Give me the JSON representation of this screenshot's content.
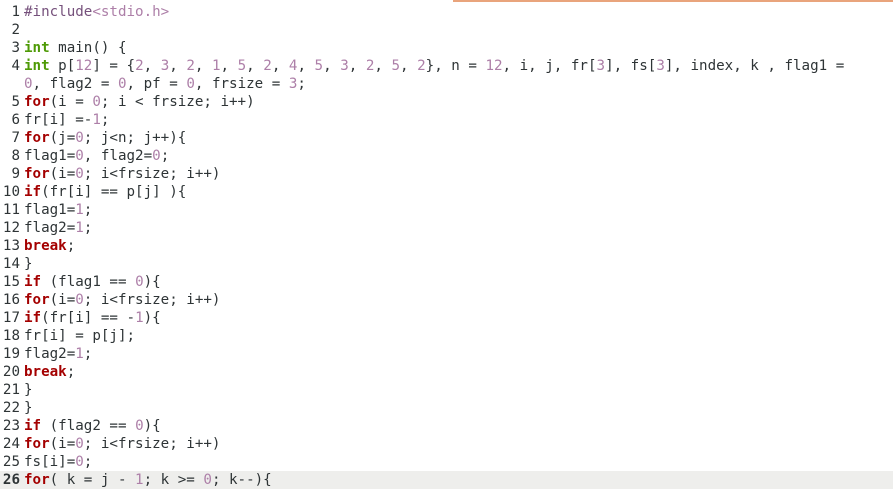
{
  "colors": {
    "keyword": "#a40000",
    "type": "#4e9a06",
    "preprocessor": "#75507b",
    "number": "#ad7fa8",
    "default": "#2e3436",
    "current_line_bg": "#eeeeec",
    "accent": "#e9a47c"
  },
  "editor": {
    "current_line": 26,
    "lines": [
      {
        "n": "1",
        "tokens": [
          {
            "t": "pp",
            "v": "#include"
          },
          {
            "t": "str",
            "v": "<stdio.h>"
          }
        ]
      },
      {
        "n": "2",
        "tokens": []
      },
      {
        "n": "3",
        "tokens": [
          {
            "t": "ty",
            "v": "int"
          },
          {
            "t": "",
            "v": " main() {"
          }
        ]
      },
      {
        "n": "4",
        "tokens": [
          {
            "t": "ty",
            "v": "int"
          },
          {
            "t": "",
            "v": " p["
          },
          {
            "t": "num",
            "v": "12"
          },
          {
            "t": "",
            "v": "] = {"
          },
          {
            "t": "num",
            "v": "2"
          },
          {
            "t": "",
            "v": ", "
          },
          {
            "t": "num",
            "v": "3"
          },
          {
            "t": "",
            "v": ", "
          },
          {
            "t": "num",
            "v": "2"
          },
          {
            "t": "",
            "v": ", "
          },
          {
            "t": "num",
            "v": "1"
          },
          {
            "t": "",
            "v": ", "
          },
          {
            "t": "num",
            "v": "5"
          },
          {
            "t": "",
            "v": ", "
          },
          {
            "t": "num",
            "v": "2"
          },
          {
            "t": "",
            "v": ", "
          },
          {
            "t": "num",
            "v": "4"
          },
          {
            "t": "",
            "v": ", "
          },
          {
            "t": "num",
            "v": "5"
          },
          {
            "t": "",
            "v": ", "
          },
          {
            "t": "num",
            "v": "3"
          },
          {
            "t": "",
            "v": ", "
          },
          {
            "t": "num",
            "v": "2"
          },
          {
            "t": "",
            "v": ", "
          },
          {
            "t": "num",
            "v": "5"
          },
          {
            "t": "",
            "v": ", "
          },
          {
            "t": "num",
            "v": "2"
          },
          {
            "t": "",
            "v": "}, n = "
          },
          {
            "t": "num",
            "v": "12"
          },
          {
            "t": "",
            "v": ", i, j, fr["
          },
          {
            "t": "num",
            "v": "3"
          },
          {
            "t": "",
            "v": "], fs["
          },
          {
            "t": "num",
            "v": "3"
          },
          {
            "t": "",
            "v": "], index, k , flag1 ="
          }
        ]
      },
      {
        "n": "",
        "tokens": [
          {
            "t": "num",
            "v": "0"
          },
          {
            "t": "",
            "v": ", flag2 = "
          },
          {
            "t": "num",
            "v": "0"
          },
          {
            "t": "",
            "v": ", pf = "
          },
          {
            "t": "num",
            "v": "0"
          },
          {
            "t": "",
            "v": ", frsize = "
          },
          {
            "t": "num",
            "v": "3"
          },
          {
            "t": "",
            "v": ";"
          }
        ]
      },
      {
        "n": "5",
        "tokens": [
          {
            "t": "kw",
            "v": "for"
          },
          {
            "t": "",
            "v": "(i = "
          },
          {
            "t": "num",
            "v": "0"
          },
          {
            "t": "",
            "v": "; i < frsize; i++)"
          }
        ]
      },
      {
        "n": "6",
        "tokens": [
          {
            "t": "",
            "v": "fr[i] =-"
          },
          {
            "t": "num",
            "v": "1"
          },
          {
            "t": "",
            "v": ";"
          }
        ]
      },
      {
        "n": "7",
        "tokens": [
          {
            "t": "kw",
            "v": "for"
          },
          {
            "t": "",
            "v": "(j="
          },
          {
            "t": "num",
            "v": "0"
          },
          {
            "t": "",
            "v": "; j<n; j++){"
          }
        ]
      },
      {
        "n": "8",
        "tokens": [
          {
            "t": "",
            "v": "flag1="
          },
          {
            "t": "num",
            "v": "0"
          },
          {
            "t": "",
            "v": ", flag2="
          },
          {
            "t": "num",
            "v": "0"
          },
          {
            "t": "",
            "v": ";"
          }
        ]
      },
      {
        "n": "9",
        "tokens": [
          {
            "t": "kw",
            "v": "for"
          },
          {
            "t": "",
            "v": "(i="
          },
          {
            "t": "num",
            "v": "0"
          },
          {
            "t": "",
            "v": "; i<frsize; i++)"
          }
        ]
      },
      {
        "n": "10",
        "tokens": [
          {
            "t": "kw",
            "v": "if"
          },
          {
            "t": "",
            "v": "(fr[i] == p[j] ){"
          }
        ]
      },
      {
        "n": "11",
        "tokens": [
          {
            "t": "",
            "v": "flag1="
          },
          {
            "t": "num",
            "v": "1"
          },
          {
            "t": "",
            "v": ";"
          }
        ]
      },
      {
        "n": "12",
        "tokens": [
          {
            "t": "",
            "v": "flag2="
          },
          {
            "t": "num",
            "v": "1"
          },
          {
            "t": "",
            "v": ";"
          }
        ]
      },
      {
        "n": "13",
        "tokens": [
          {
            "t": "kw",
            "v": "break"
          },
          {
            "t": "",
            "v": ";"
          }
        ]
      },
      {
        "n": "14",
        "tokens": [
          {
            "t": "",
            "v": "}"
          }
        ]
      },
      {
        "n": "15",
        "tokens": [
          {
            "t": "kw",
            "v": "if"
          },
          {
            "t": "",
            "v": " (flag1 == "
          },
          {
            "t": "num",
            "v": "0"
          },
          {
            "t": "",
            "v": "){"
          }
        ]
      },
      {
        "n": "16",
        "tokens": [
          {
            "t": "kw",
            "v": "for"
          },
          {
            "t": "",
            "v": "(i="
          },
          {
            "t": "num",
            "v": "0"
          },
          {
            "t": "",
            "v": "; i<frsize; i++)"
          }
        ]
      },
      {
        "n": "17",
        "tokens": [
          {
            "t": "kw",
            "v": "if"
          },
          {
            "t": "",
            "v": "(fr[i] == -"
          },
          {
            "t": "num",
            "v": "1"
          },
          {
            "t": "",
            "v": "){"
          }
        ]
      },
      {
        "n": "18",
        "tokens": [
          {
            "t": "",
            "v": "fr[i] = p[j];"
          }
        ]
      },
      {
        "n": "19",
        "tokens": [
          {
            "t": "",
            "v": "flag2="
          },
          {
            "t": "num",
            "v": "1"
          },
          {
            "t": "",
            "v": ";"
          }
        ]
      },
      {
        "n": "20",
        "tokens": [
          {
            "t": "kw",
            "v": "break"
          },
          {
            "t": "",
            "v": ";"
          }
        ]
      },
      {
        "n": "21",
        "tokens": [
          {
            "t": "",
            "v": "}"
          }
        ]
      },
      {
        "n": "22",
        "tokens": [
          {
            "t": "",
            "v": "}"
          }
        ]
      },
      {
        "n": "23",
        "tokens": [
          {
            "t": "kw",
            "v": "if"
          },
          {
            "t": "",
            "v": " (flag2 == "
          },
          {
            "t": "num",
            "v": "0"
          },
          {
            "t": "",
            "v": "){"
          }
        ]
      },
      {
        "n": "24",
        "tokens": [
          {
            "t": "kw",
            "v": "for"
          },
          {
            "t": "",
            "v": "(i="
          },
          {
            "t": "num",
            "v": "0"
          },
          {
            "t": "",
            "v": "; i<frsize; i++)"
          }
        ]
      },
      {
        "n": "25",
        "tokens": [
          {
            "t": "",
            "v": "fs[i]="
          },
          {
            "t": "num",
            "v": "0"
          },
          {
            "t": "",
            "v": ";"
          }
        ]
      },
      {
        "n": "26",
        "tokens": [
          {
            "t": "kw",
            "v": "for"
          },
          {
            "t": "",
            "v": "( k = j - "
          },
          {
            "t": "num",
            "v": "1"
          },
          {
            "t": "",
            "v": "; k >= "
          },
          {
            "t": "num",
            "v": "0"
          },
          {
            "t": "",
            "v": "; k--){"
          }
        ]
      }
    ]
  }
}
